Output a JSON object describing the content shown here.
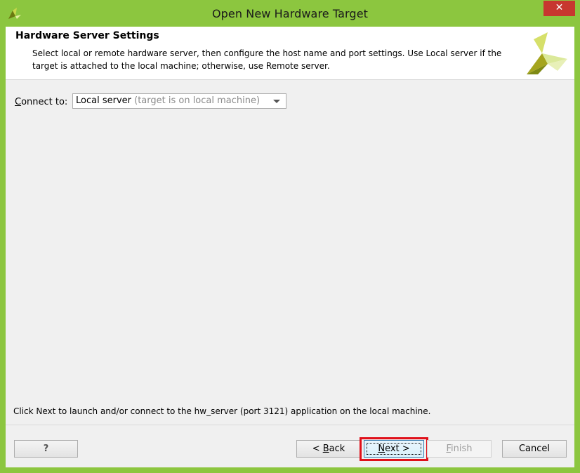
{
  "window": {
    "title": "Open New Hardware Target",
    "close_label": "✕",
    "icon": "xilinx-logo-icon"
  },
  "header": {
    "title": "Hardware Server Settings",
    "description": "Select local or remote hardware server, then configure the host name and port settings. Use Local server if the target is attached to the local machine; otherwise, use Remote server.",
    "logo_icon": "xilinx-logo-icon"
  },
  "connect": {
    "label_accel": "C",
    "label_rest": "onnect to:",
    "selected_value": "Local server",
    "selected_hint": "(target is on local machine)",
    "dropdown_icon": "chevron-down-icon"
  },
  "info": {
    "text": "Click Next to launch and/or connect to the hw_server (port 3121) application on the local machine."
  },
  "buttons": {
    "help": "?",
    "back_prefix": "< ",
    "back_accel": "B",
    "back_rest": "ack",
    "next_accel": "N",
    "next_rest": "ext >",
    "finish_accel": "F",
    "finish_rest": "inish",
    "cancel": "Cancel"
  },
  "colors": {
    "frame": "#8cc63f",
    "close": "#c7372f",
    "highlight": "#e0101a",
    "logo_dark": "#a5a51e",
    "logo_light": "#d9e88a"
  }
}
